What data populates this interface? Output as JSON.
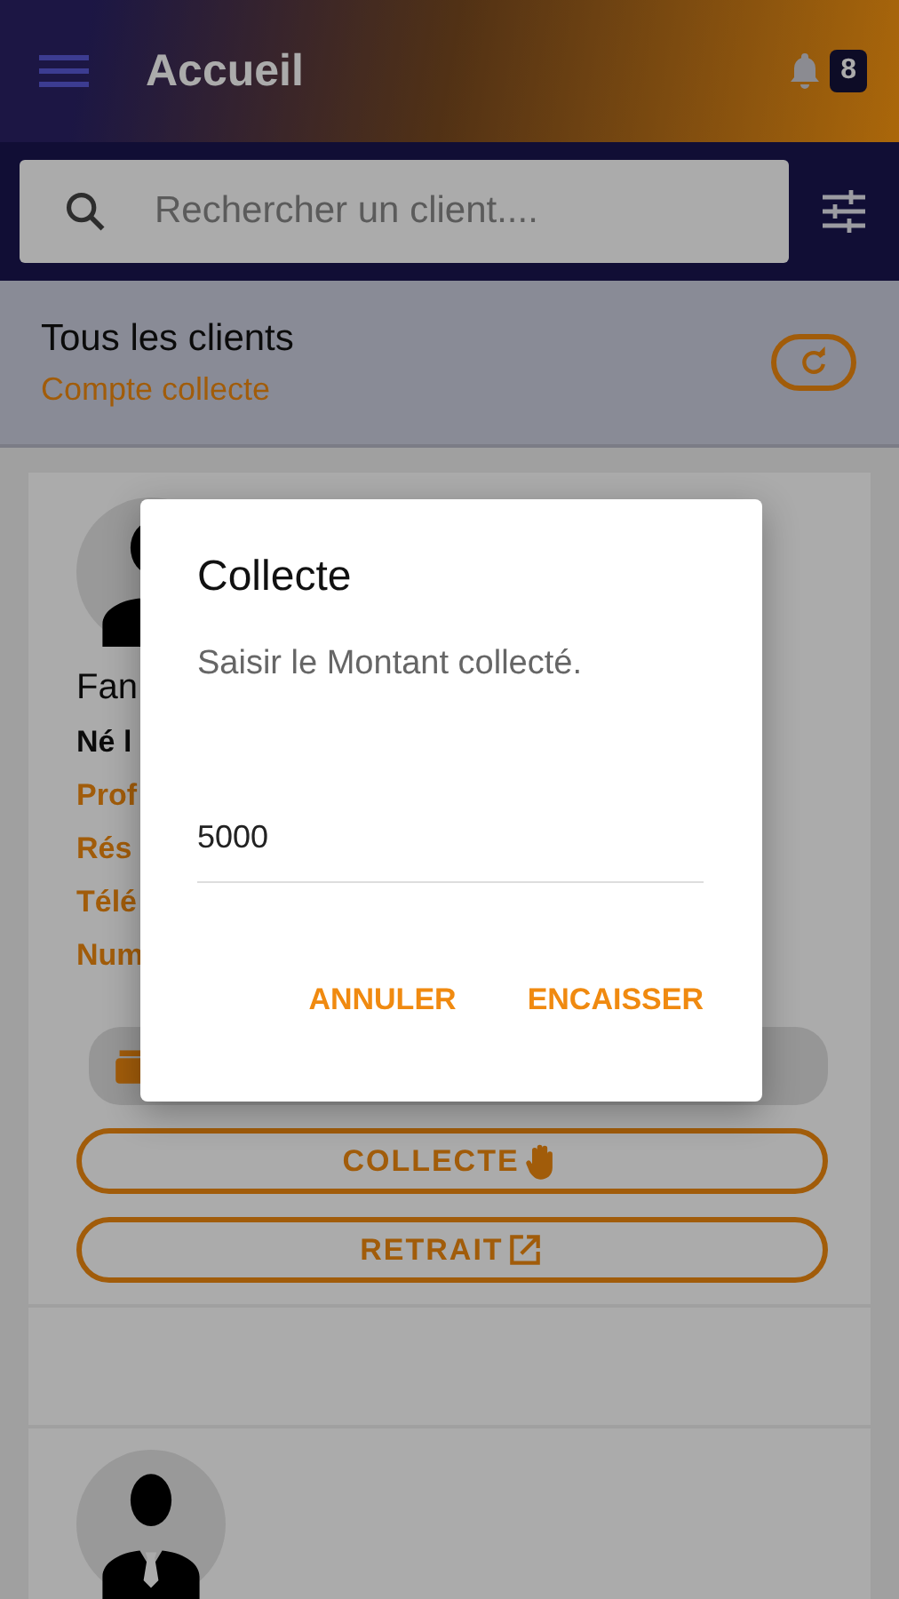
{
  "header": {
    "title": "Accueil",
    "notification_count": "8"
  },
  "search": {
    "placeholder": "Rechercher un client...."
  },
  "section": {
    "title": "Tous les clients",
    "subtitle": "Compte collecte"
  },
  "client": {
    "name": "Fan",
    "birth": "Né l",
    "fields": [
      "Prof",
      "Rés",
      "Télé",
      "Num"
    ],
    "buttons": [
      {
        "label": "COLLECTE",
        "kind": "collect"
      },
      {
        "label": "RETRAIT",
        "kind": "withdraw"
      }
    ]
  },
  "dialog": {
    "title": "Collecte",
    "message": "Saisir le Montant collecté.",
    "amount": "5000",
    "actions": [
      "ANNULER",
      "ENCAISSER"
    ]
  }
}
